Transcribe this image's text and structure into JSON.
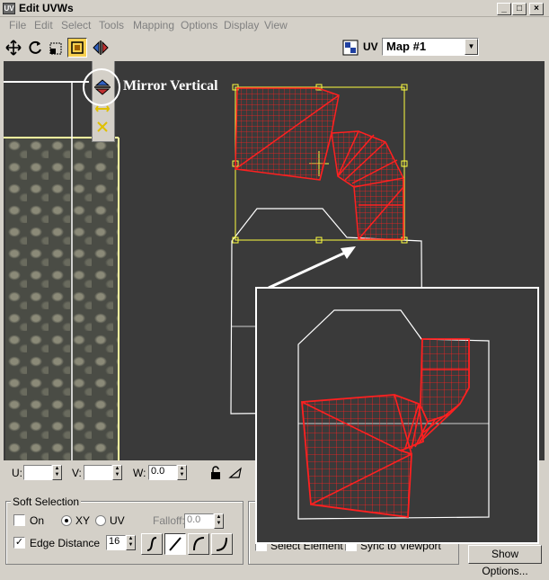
{
  "window": {
    "title": "Edit UVWs",
    "icon_label": "UV",
    "minimize": "_",
    "maximize": "□",
    "close": "×"
  },
  "menu": [
    "File",
    "Edit",
    "Select",
    "Tools",
    "Mapping",
    "Options",
    "Display",
    "View"
  ],
  "toolbar": {
    "uv_label": "UV",
    "map_value": "Map #1",
    "icons": [
      "move-icon",
      "rotate-icon",
      "scale-icon",
      "freeform-icon",
      "mirror-horizontal-icon"
    ],
    "flyout_icons": [
      "mirror-vertical-icon",
      "flip-horizontal-icon",
      "flip-vertical-icon"
    ]
  },
  "annotation": {
    "text": "Mirror Vertical"
  },
  "status": {
    "u_label": "U:",
    "v_label": "V:",
    "w_label": "W:",
    "w_value": "0.0",
    "u_value": "",
    "v_value": ""
  },
  "soft_selection": {
    "title": "Soft Selection",
    "on_label": "On",
    "xy_label": "XY",
    "uv_label": "UV",
    "falloff_label": "Falloff:",
    "falloff_value": "0.0",
    "edge_distance_label": "Edge Distance",
    "edge_distance_value": "16",
    "on_checked": false,
    "edge_checked": true,
    "mode": "XY"
  },
  "selection": {
    "select_element_label": "Select Element",
    "sync_label": "Sync to Viewport",
    "show_options_label": "Show Options..."
  },
  "colors": {
    "uv_mesh": "#ff2020",
    "selection_box": "#ffff40",
    "viewport_bg": "#3a3a3a",
    "pressed_button": "#f7d050"
  }
}
